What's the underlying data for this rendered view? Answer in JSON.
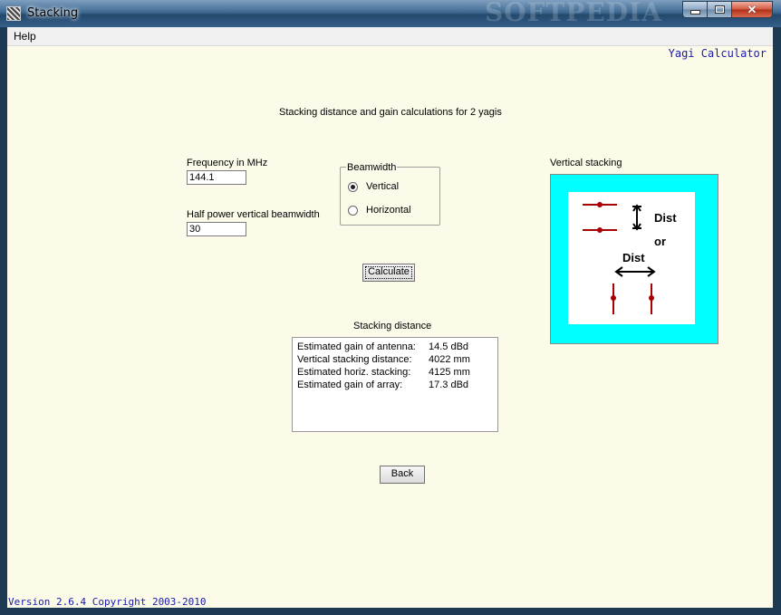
{
  "window": {
    "title": "Stacking",
    "watermark": "SOFTPEDIA"
  },
  "menu": {
    "help": "Help"
  },
  "brand": "Yagi Calculator",
  "heading": "Stacking distance and gain calculations for 2 yagis",
  "frequency": {
    "label": "Frequency in MHz",
    "value": "144.1"
  },
  "beamwidth_input": {
    "label": "Half power vertical beamwidth",
    "value": "30"
  },
  "beamwidth_group": {
    "legend": "Beamwidth",
    "options": [
      {
        "label": "Vertical",
        "checked": true
      },
      {
        "label": "Horizontal",
        "checked": false
      }
    ]
  },
  "calculate_label": "Calculate",
  "results": {
    "title": "Stacking distance",
    "rows": [
      {
        "label": "Estimated gain of antenna:",
        "value": "14.5 dBd"
      },
      {
        "label": "Vertical stacking distance:",
        "value": "4022 mm"
      },
      {
        "label": "Estimated horiz. stacking:",
        "value": "4125 mm"
      },
      {
        "label": "Estimated gain of array:",
        "value": "17.3 dBd"
      }
    ]
  },
  "diagram": {
    "title": "Vertical stacking",
    "dist_top": "Dist",
    "or": "or",
    "dist_bottom": "Dist"
  },
  "back_label": "Back",
  "version": "Version 2.6.4 Copyright 2003-2010",
  "colors": {
    "title_text": "#1a1aa8",
    "diagram_frame": "#00ffff",
    "element_red": "#a80000"
  }
}
